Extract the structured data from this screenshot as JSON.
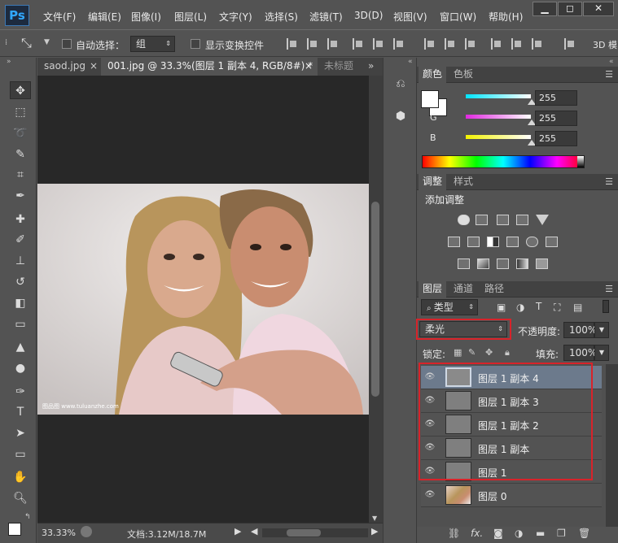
{
  "app": {
    "logo": "Ps"
  },
  "menu": [
    "文件(F)",
    "编辑(E)",
    "图像(I)",
    "图层(L)",
    "文字(Y)",
    "选择(S)",
    "滤镜(T)",
    "3D(D)",
    "视图(V)",
    "窗口(W)",
    "帮助(H)"
  ],
  "window_controls": {
    "minimize": "▁",
    "restore": "◻",
    "close": "✕"
  },
  "options_bar": {
    "auto_select_label": "自动选择：",
    "auto_select_value": "组",
    "show_transform_label": "显示变换控件",
    "mode_3d": "3D 模"
  },
  "doc_tabs": [
    {
      "label": "saod.jpg",
      "close": "×"
    },
    {
      "label": "001.jpg @ 33.3%(图层 1 副本 4, RGB/8#) *",
      "close": "×"
    },
    {
      "label": "未标题",
      "close": ""
    }
  ],
  "tabs_overflow": "»",
  "photo": {
    "watermark": "图品图 www.tuluanzhe.com"
  },
  "status": {
    "zoom": "33.33%",
    "doc_info": "文档:3.12M/18.7M"
  },
  "color_panel": {
    "tabs": [
      "颜色",
      "色板"
    ],
    "channels": [
      {
        "label": "R",
        "value": "255",
        "color": "#00e5ff"
      },
      {
        "label": "G",
        "value": "255",
        "color": "#e028e0"
      },
      {
        "label": "B",
        "value": "255",
        "color": "#f2f200"
      }
    ]
  },
  "adjust_panel": {
    "tabs": [
      "调整",
      "样式"
    ],
    "title": "添加调整"
  },
  "layers_panel": {
    "tabs": [
      "图层",
      "通道",
      "路径"
    ],
    "filter_kind": "类型",
    "blend_mode": "柔光",
    "opacity_label": "不透明度:",
    "opacity_value": "100%",
    "lock_label": "锁定:",
    "fill_label": "填充:",
    "fill_value": "100%",
    "layers": [
      {
        "name": "图层 1 副本 4",
        "selected": true
      },
      {
        "name": "图层 1 副本 3",
        "selected": false
      },
      {
        "name": "图层 1 副本 2",
        "selected": false
      },
      {
        "name": "图层 1 副本",
        "selected": false
      },
      {
        "name": "图层 1",
        "selected": false
      },
      {
        "name": "图层 0",
        "selected": false
      }
    ],
    "footer_icons": [
      "link-icon",
      "fx-icon",
      "mask-icon",
      "adjustment-icon",
      "group-icon",
      "new-layer-icon",
      "trash-icon"
    ],
    "footer_fx": "fx."
  },
  "highlight_color": "#d8232a"
}
